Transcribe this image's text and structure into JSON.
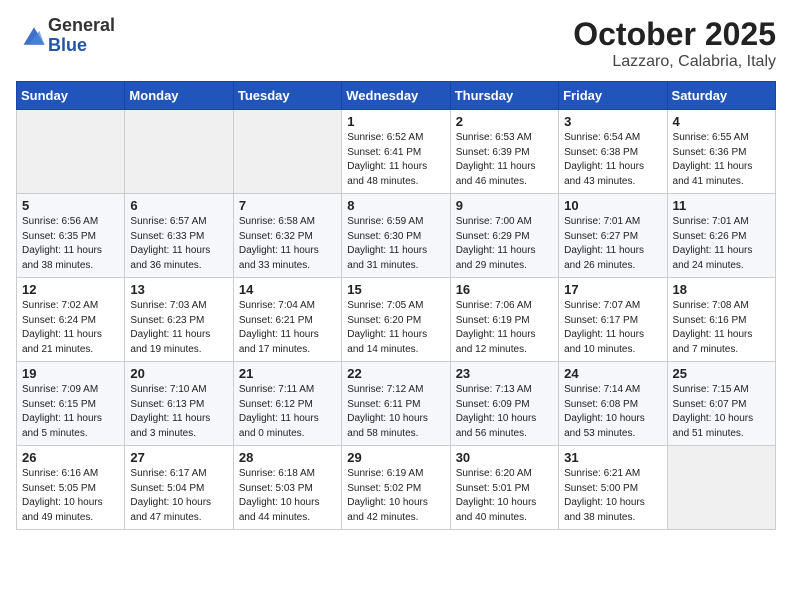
{
  "logo": {
    "general": "General",
    "blue": "Blue"
  },
  "title": "October 2025",
  "location": "Lazzaro, Calabria, Italy",
  "weekdays": [
    "Sunday",
    "Monday",
    "Tuesday",
    "Wednesday",
    "Thursday",
    "Friday",
    "Saturday"
  ],
  "weeks": [
    [
      {
        "day": "",
        "info": ""
      },
      {
        "day": "",
        "info": ""
      },
      {
        "day": "",
        "info": ""
      },
      {
        "day": "1",
        "info": "Sunrise: 6:52 AM\nSunset: 6:41 PM\nDaylight: 11 hours\nand 48 minutes."
      },
      {
        "day": "2",
        "info": "Sunrise: 6:53 AM\nSunset: 6:39 PM\nDaylight: 11 hours\nand 46 minutes."
      },
      {
        "day": "3",
        "info": "Sunrise: 6:54 AM\nSunset: 6:38 PM\nDaylight: 11 hours\nand 43 minutes."
      },
      {
        "day": "4",
        "info": "Sunrise: 6:55 AM\nSunset: 6:36 PM\nDaylight: 11 hours\nand 41 minutes."
      }
    ],
    [
      {
        "day": "5",
        "info": "Sunrise: 6:56 AM\nSunset: 6:35 PM\nDaylight: 11 hours\nand 38 minutes."
      },
      {
        "day": "6",
        "info": "Sunrise: 6:57 AM\nSunset: 6:33 PM\nDaylight: 11 hours\nand 36 minutes."
      },
      {
        "day": "7",
        "info": "Sunrise: 6:58 AM\nSunset: 6:32 PM\nDaylight: 11 hours\nand 33 minutes."
      },
      {
        "day": "8",
        "info": "Sunrise: 6:59 AM\nSunset: 6:30 PM\nDaylight: 11 hours\nand 31 minutes."
      },
      {
        "day": "9",
        "info": "Sunrise: 7:00 AM\nSunset: 6:29 PM\nDaylight: 11 hours\nand 29 minutes."
      },
      {
        "day": "10",
        "info": "Sunrise: 7:01 AM\nSunset: 6:27 PM\nDaylight: 11 hours\nand 26 minutes."
      },
      {
        "day": "11",
        "info": "Sunrise: 7:01 AM\nSunset: 6:26 PM\nDaylight: 11 hours\nand 24 minutes."
      }
    ],
    [
      {
        "day": "12",
        "info": "Sunrise: 7:02 AM\nSunset: 6:24 PM\nDaylight: 11 hours\nand 21 minutes."
      },
      {
        "day": "13",
        "info": "Sunrise: 7:03 AM\nSunset: 6:23 PM\nDaylight: 11 hours\nand 19 minutes."
      },
      {
        "day": "14",
        "info": "Sunrise: 7:04 AM\nSunset: 6:21 PM\nDaylight: 11 hours\nand 17 minutes."
      },
      {
        "day": "15",
        "info": "Sunrise: 7:05 AM\nSunset: 6:20 PM\nDaylight: 11 hours\nand 14 minutes."
      },
      {
        "day": "16",
        "info": "Sunrise: 7:06 AM\nSunset: 6:19 PM\nDaylight: 11 hours\nand 12 minutes."
      },
      {
        "day": "17",
        "info": "Sunrise: 7:07 AM\nSunset: 6:17 PM\nDaylight: 11 hours\nand 10 minutes."
      },
      {
        "day": "18",
        "info": "Sunrise: 7:08 AM\nSunset: 6:16 PM\nDaylight: 11 hours\nand 7 minutes."
      }
    ],
    [
      {
        "day": "19",
        "info": "Sunrise: 7:09 AM\nSunset: 6:15 PM\nDaylight: 11 hours\nand 5 minutes."
      },
      {
        "day": "20",
        "info": "Sunrise: 7:10 AM\nSunset: 6:13 PM\nDaylight: 11 hours\nand 3 minutes."
      },
      {
        "day": "21",
        "info": "Sunrise: 7:11 AM\nSunset: 6:12 PM\nDaylight: 11 hours\nand 0 minutes."
      },
      {
        "day": "22",
        "info": "Sunrise: 7:12 AM\nSunset: 6:11 PM\nDaylight: 10 hours\nand 58 minutes."
      },
      {
        "day": "23",
        "info": "Sunrise: 7:13 AM\nSunset: 6:09 PM\nDaylight: 10 hours\nand 56 minutes."
      },
      {
        "day": "24",
        "info": "Sunrise: 7:14 AM\nSunset: 6:08 PM\nDaylight: 10 hours\nand 53 minutes."
      },
      {
        "day": "25",
        "info": "Sunrise: 7:15 AM\nSunset: 6:07 PM\nDaylight: 10 hours\nand 51 minutes."
      }
    ],
    [
      {
        "day": "26",
        "info": "Sunrise: 6:16 AM\nSunset: 5:05 PM\nDaylight: 10 hours\nand 49 minutes."
      },
      {
        "day": "27",
        "info": "Sunrise: 6:17 AM\nSunset: 5:04 PM\nDaylight: 10 hours\nand 47 minutes."
      },
      {
        "day": "28",
        "info": "Sunrise: 6:18 AM\nSunset: 5:03 PM\nDaylight: 10 hours\nand 44 minutes."
      },
      {
        "day": "29",
        "info": "Sunrise: 6:19 AM\nSunset: 5:02 PM\nDaylight: 10 hours\nand 42 minutes."
      },
      {
        "day": "30",
        "info": "Sunrise: 6:20 AM\nSunset: 5:01 PM\nDaylight: 10 hours\nand 40 minutes."
      },
      {
        "day": "31",
        "info": "Sunrise: 6:21 AM\nSunset: 5:00 PM\nDaylight: 10 hours\nand 38 minutes."
      },
      {
        "day": "",
        "info": ""
      }
    ]
  ]
}
